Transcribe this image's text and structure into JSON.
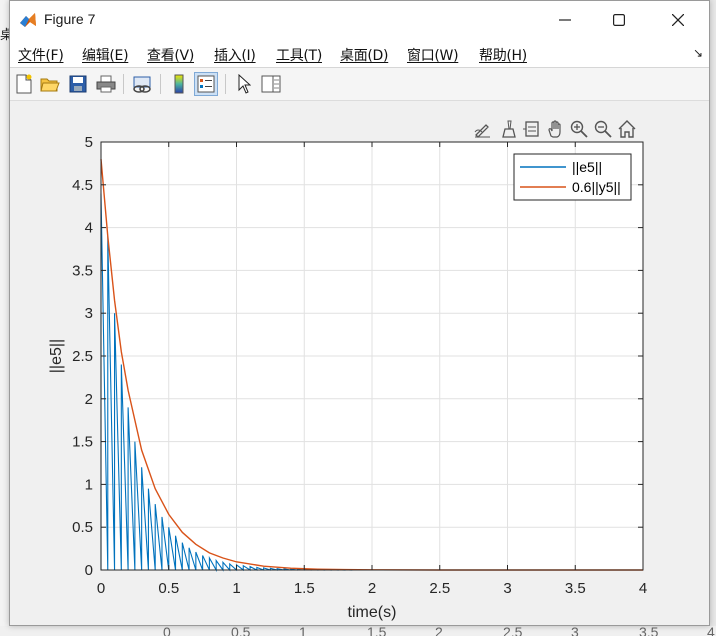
{
  "background": {
    "left_char": "桌",
    "bottom_ticks": [
      "0",
      "0.5",
      "1",
      "1.5",
      "2",
      "2.5",
      "3",
      "3.5",
      "4"
    ]
  },
  "window": {
    "title": "Figure 7",
    "controls": {
      "minimize": "minimize",
      "maximize": "maximize",
      "close": "close"
    }
  },
  "menubar": {
    "items": [
      {
        "label": "文件(F)"
      },
      {
        "label": "编辑(E)"
      },
      {
        "label": "查看(V)"
      },
      {
        "label": "插入(I)"
      },
      {
        "label": "工具(T)"
      },
      {
        "label": "桌面(D)"
      },
      {
        "label": "窗口(W)"
      },
      {
        "label": "帮助(H)"
      }
    ],
    "overflow_icon": "dock-arrow-icon"
  },
  "toolbar": {
    "buttons": [
      "new-figure-icon",
      "open-file-icon",
      "save-icon",
      "print-icon",
      "link-plot-icon",
      "colorbar-icon",
      "legend-icon",
      "pointer-icon",
      "property-editor-icon"
    ],
    "active": "legend-icon"
  },
  "axes_toolbar": {
    "buttons": [
      "edit-plot-icon",
      "brush-icon",
      "data-tip-icon",
      "pan-icon",
      "zoom-in-icon",
      "zoom-out-icon",
      "home-icon"
    ]
  },
  "chart_data": {
    "type": "line",
    "xlabel": "time(s)",
    "ylabel": "||e5||",
    "xlim": [
      0,
      4
    ],
    "ylim": [
      0,
      5
    ],
    "xticks": [
      "0",
      "0.5",
      "1",
      "1.5",
      "2",
      "2.5",
      "3",
      "3.5",
      "4"
    ],
    "yticks": [
      "0",
      "0.5",
      "1",
      "1.5",
      "2",
      "2.5",
      "3",
      "3.5",
      "4",
      "4.5",
      "5"
    ],
    "grid": true,
    "legend_position": "top-right",
    "series": [
      {
        "name": "||e5||",
        "color": "#0072BD",
        "style": "sawtooth",
        "x": [
          0,
          0.05,
          0.1,
          0.15,
          0.2,
          0.25,
          0.3,
          0.35,
          0.4,
          0.45,
          0.5,
          0.55,
          0.6,
          0.65,
          0.7,
          0.75,
          0.8,
          0.85,
          0.9,
          0.95,
          1.0,
          1.05,
          1.1,
          1.15,
          1.2,
          1.25,
          1.3,
          1.35,
          1.4,
          1.45,
          1.5,
          1.55,
          1.6,
          1.65,
          1.7,
          1.75,
          1.8,
          1.85,
          1.9,
          1.95,
          2.0
        ],
        "peaks": [
          4.4,
          3.9,
          3.0,
          2.4,
          1.9,
          1.5,
          1.2,
          0.95,
          0.77,
          0.62,
          0.5,
          0.4,
          0.32,
          0.26,
          0.21,
          0.17,
          0.14,
          0.11,
          0.09,
          0.07,
          0.06,
          0.05,
          0.04,
          0.03,
          0.025,
          0.02,
          0.016,
          0.013,
          0.01,
          0.008,
          0.007,
          0.005,
          0.004,
          0.003,
          0.003,
          0.002,
          0.002,
          0.001,
          0.001,
          0.001,
          0.0
        ]
      },
      {
        "name": "0.6||y5||",
        "color": "#D95319",
        "style": "line",
        "x": [
          0,
          0.05,
          0.1,
          0.15,
          0.2,
          0.3,
          0.4,
          0.5,
          0.6,
          0.7,
          0.8,
          0.9,
          1.0,
          1.2,
          1.4,
          1.6,
          1.8,
          2.0,
          2.5,
          3.0,
          3.5,
          4.0
        ],
        "y": [
          4.8,
          3.9,
          3.15,
          2.55,
          2.1,
          1.4,
          0.95,
          0.65,
          0.44,
          0.3,
          0.2,
          0.14,
          0.095,
          0.045,
          0.021,
          0.01,
          0.005,
          0.002,
          0.0,
          0.0,
          0.0,
          0.0
        ]
      }
    ]
  }
}
